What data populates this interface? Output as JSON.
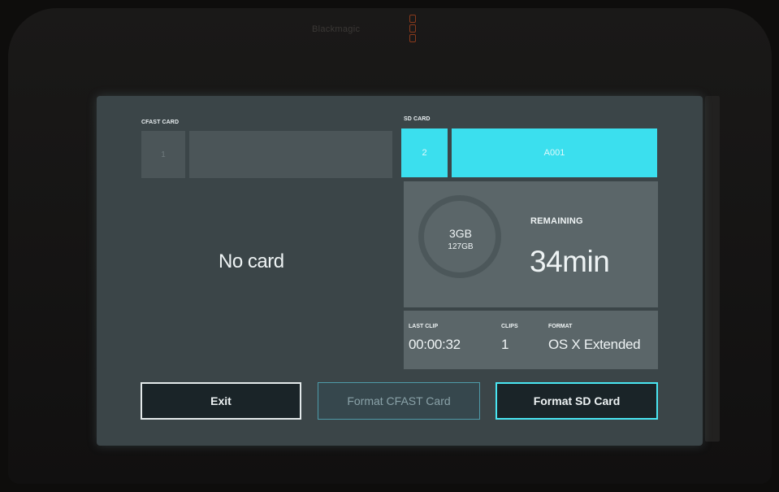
{
  "device": {
    "brand": "Blackmagic"
  },
  "cfast": {
    "label": "CFAST CARD",
    "slot_number": "1",
    "status": "No card"
  },
  "sd": {
    "label": "SD CARD",
    "slot_number": "2",
    "clip_name": "A001",
    "used": "3GB",
    "total": "127GB",
    "remaining_label": "REMAINING",
    "remaining_value": "34min",
    "last_clip_label": "LAST CLIP",
    "last_clip_value": "00:00:32",
    "clips_label": "CLIPS",
    "clips_value": "1",
    "format_label": "FORMAT",
    "format_value": "OS X Extended"
  },
  "buttons": {
    "exit": "Exit",
    "format_cfast": "Format CFAST Card",
    "format_sd": "Format SD Card"
  },
  "colors": {
    "accent": "#3bdfee",
    "panel": "#5b6669",
    "screen_bg": "#3b4548"
  }
}
